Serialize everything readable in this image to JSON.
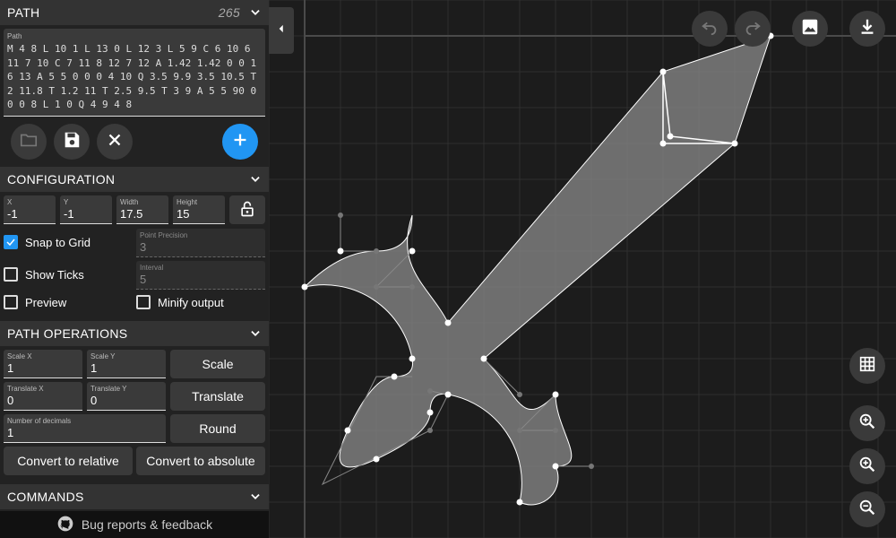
{
  "path_section": {
    "title": "PATH",
    "count": "265",
    "field_label": "Path",
    "value": "M 4 8 L 10 1 L 13 0 L 12 3 L 5 9 C 6 10 6 11 7 10 C 7 11 8 12 7 12 A 1.42 1.42 0 0 1 6 13 A 5 5 0 0 0 4 10 Q 3.5 9.9 3.5 10.5 T 2 11.8 T 1.2 11 T 2.5 9.5 T 3 9 A 5 5 90 0 0 0 8 L 1 0 Q 4 9 4 8"
  },
  "path_actions": {
    "open_icon": "folder-icon",
    "save_icon": "save-icon",
    "clear_icon": "close-icon",
    "add_icon": "plus-icon"
  },
  "configuration": {
    "title": "CONFIGURATION",
    "x": {
      "label": "X",
      "value": "-1"
    },
    "y": {
      "label": "Y",
      "value": "-1"
    },
    "width": {
      "label": "Width",
      "value": "17.5"
    },
    "height": {
      "label": "Height",
      "value": "15"
    },
    "lock_icon": "lock-open-icon",
    "snap_to_grid": {
      "label": "Snap to Grid",
      "checked": true
    },
    "show_ticks": {
      "label": "Show Ticks",
      "checked": false
    },
    "preview": {
      "label": "Preview",
      "checked": false
    },
    "minify_output": {
      "label": "Minify output",
      "checked": false
    },
    "point_precision": {
      "label": "Point Precision",
      "value": "3"
    },
    "interval": {
      "label": "Interval",
      "value": "5"
    }
  },
  "path_operations": {
    "title": "PATH OPERATIONS",
    "scale_x": {
      "label": "Scale X",
      "value": "1"
    },
    "scale_y": {
      "label": "Scale Y",
      "value": "1"
    },
    "scale_button": "Scale",
    "translate_x": {
      "label": "Translate X",
      "value": "0"
    },
    "translate_y": {
      "label": "Translate Y",
      "value": "0"
    },
    "translate_button": "Translate",
    "decimals": {
      "label": "Number of decimals",
      "value": "1"
    },
    "round_button": "Round",
    "to_relative_button": "Convert to relative",
    "to_absolute_button": "Convert to absolute"
  },
  "commands": {
    "title": "COMMANDS"
  },
  "footer": {
    "text": "Bug reports & feedback",
    "icon": "github-icon"
  },
  "toolbar": {
    "undo_icon": "undo-icon",
    "redo_icon": "redo-icon",
    "image_icon": "image-icon",
    "download_icon": "download-icon",
    "grid_icon": "grid-icon",
    "zoom_fit_icon": "zoom-fit-icon",
    "zoom_in_icon": "zoom-in-icon",
    "zoom_out_icon": "zoom-out-icon",
    "collapse_icon": "chevron-left-icon"
  },
  "colors": {
    "accent": "#2196f3",
    "shape_fill": "#8a8a8a",
    "grid_line": "#2e2e2e"
  }
}
